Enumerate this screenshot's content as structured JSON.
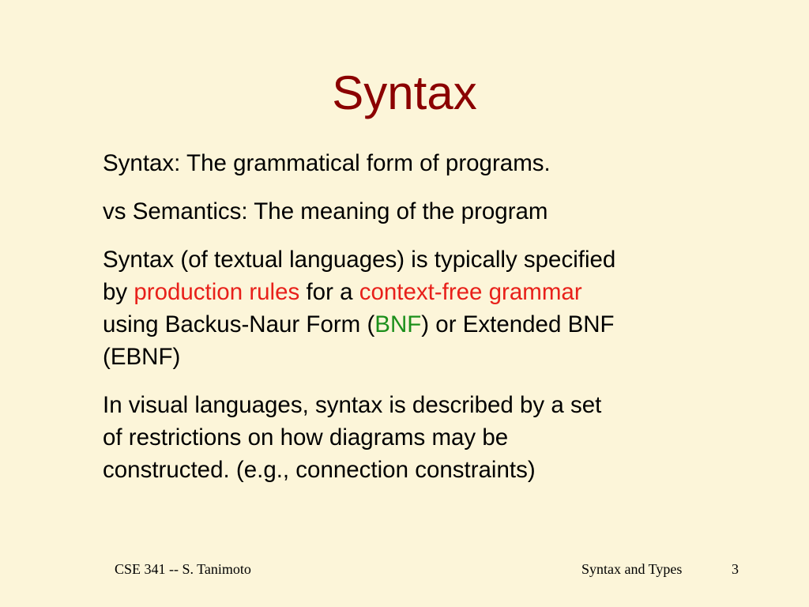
{
  "slide": {
    "title": "Syntax",
    "p1": "Syntax:  The grammatical form of programs.",
    "p2": "vs Semantics:  The meaning of the program",
    "p3": {
      "line1": "Syntax (of textual languages) is typically specified",
      "l2_a": "by ",
      "l2_b": "production rules",
      "l2_c": " for a ",
      "l2_d": "context-free grammar",
      "l3_a": "using Backus-Naur Form (",
      "l3_b": "BNF",
      "l3_c": ") or Extended BNF",
      "line4": "(EBNF)"
    },
    "p4": {
      "line1": "In visual languages, syntax is described by a set",
      "line2": "of restrictions on how diagrams may be",
      "line3": "constructed. (e.g., connection constraints)"
    },
    "footer": {
      "left": "CSE 341 -- S. Tanimoto",
      "center": "Syntax and Types",
      "page": "3"
    },
    "colors": {
      "background": "#fcf5d9",
      "title": "#8b0000",
      "highlight_red": "#e8201a",
      "highlight_green": "#1b8f1b"
    }
  }
}
